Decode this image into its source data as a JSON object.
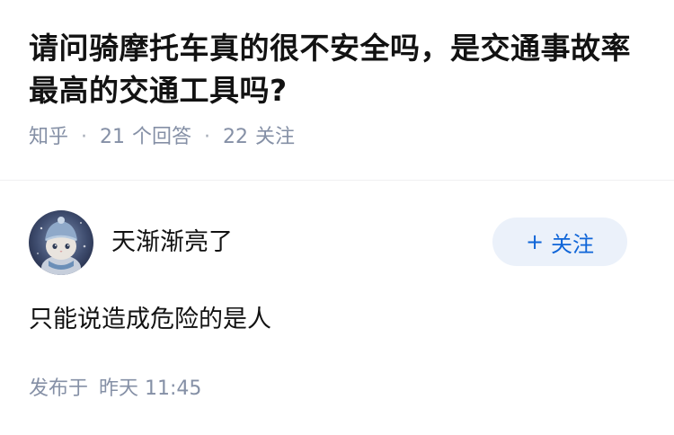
{
  "question": {
    "title": "请问骑摩托车真的很不安全吗，是交通事故率最高的交通工具吗?",
    "source": "知乎",
    "answer_count": "21",
    "answer_label": "个回答",
    "follower_count": "22",
    "follower_label": "关注",
    "separator": "·"
  },
  "answer": {
    "author_name": "天渐渐亮了",
    "follow_button": {
      "icon": "+",
      "label": "关注"
    },
    "content": "只能说造成危险的是人",
    "time_prefix": "发布于",
    "time": "昨天 11:45"
  },
  "colors": {
    "meta_text": "#8590a6",
    "follow_bg": "#ebf1fa",
    "follow_text": "#0f65d8"
  }
}
